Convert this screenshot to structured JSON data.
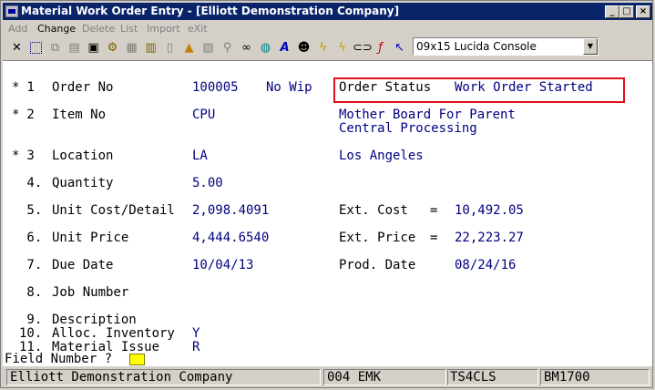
{
  "window": {
    "title": "Material Work Order Entry - [Elliott Demonstration Company]",
    "controls": {
      "minimize": "_",
      "maximize": "□",
      "close": "×"
    }
  },
  "menu": {
    "items": [
      {
        "label": "Add",
        "enabled": false
      },
      {
        "label": "Change",
        "enabled": true
      },
      {
        "label": "Delete",
        "enabled": false
      },
      {
        "label": "List",
        "enabled": false
      },
      {
        "label": "Import",
        "enabled": false
      },
      {
        "label": "eXit",
        "enabled": false
      }
    ]
  },
  "toolbar": {
    "icons": [
      "close-x-icon",
      "select-box-icon",
      "copy-icon",
      "paste-icon",
      "toolbox-icon",
      "gear-icon",
      "window-icon",
      "notes-icon",
      "file-icon",
      "bell-icon",
      "paint-icon",
      "search-icon",
      "binoculars-icon",
      "globe-icon",
      "font-icon",
      "contact-icon",
      "lightning-icon",
      "lightning-help-icon",
      "link-icon",
      "function-icon",
      "arrow-question-icon"
    ],
    "font_select": {
      "value": "09x15 Lucida Console"
    }
  },
  "form": {
    "fields": [
      {
        "marker": "*",
        "num": " 1",
        "label": "Order No",
        "value": "100005",
        "value2": "No Wip"
      },
      {
        "marker": "*",
        "num": " 2",
        "label": "Item No",
        "value": "CPU",
        "desc1": "Mother Board For Parent",
        "desc2": "Central Processing"
      },
      {
        "marker": "*",
        "num": " 3",
        "label": "Location",
        "value": "LA",
        "desc1": "Los Angeles"
      },
      {
        "marker": "",
        "num": " 4.",
        "label": "Quantity",
        "value": "5.00"
      },
      {
        "marker": "",
        "num": " 5.",
        "label": "Unit Cost/Detail",
        "value": "2,098.4091",
        "ext_label": "Ext. Cost",
        "eq": "=",
        "ext_value": "10,492.05"
      },
      {
        "marker": "",
        "num": " 6.",
        "label": "Unit Price",
        "value": "4,444.6540",
        "ext_label": "Ext. Price",
        "eq": "=",
        "ext_value": "22,223.27"
      },
      {
        "marker": "",
        "num": " 7.",
        "label": "Due Date",
        "value": "10/04/13",
        "ext_label": "Prod. Date",
        "ext_value": "08/24/16"
      },
      {
        "marker": "",
        "num": " 8.",
        "label": "Job Number",
        "value": ""
      },
      {
        "marker": "",
        "num": " 9.",
        "label": "Description",
        "value": ""
      },
      {
        "marker": "",
        "num": "10.",
        "label": "Alloc. Inventory",
        "value": "Y"
      },
      {
        "marker": "",
        "num": "11.",
        "label": "Material Issue",
        "value": "R"
      }
    ],
    "order_status": {
      "label": "Order Status",
      "value": "Work Order Started"
    }
  },
  "prompt": {
    "text": "Field Number ?"
  },
  "statusbar": {
    "company": "Elliott Demonstration Company",
    "user": "004 EMK",
    "terminal": "TS4CLS",
    "program": "BM1700"
  },
  "colors": {
    "title_bar": "#0a246a",
    "value_text": "#000080",
    "highlight_box": "#e01020",
    "cursor": "#ffff00"
  }
}
